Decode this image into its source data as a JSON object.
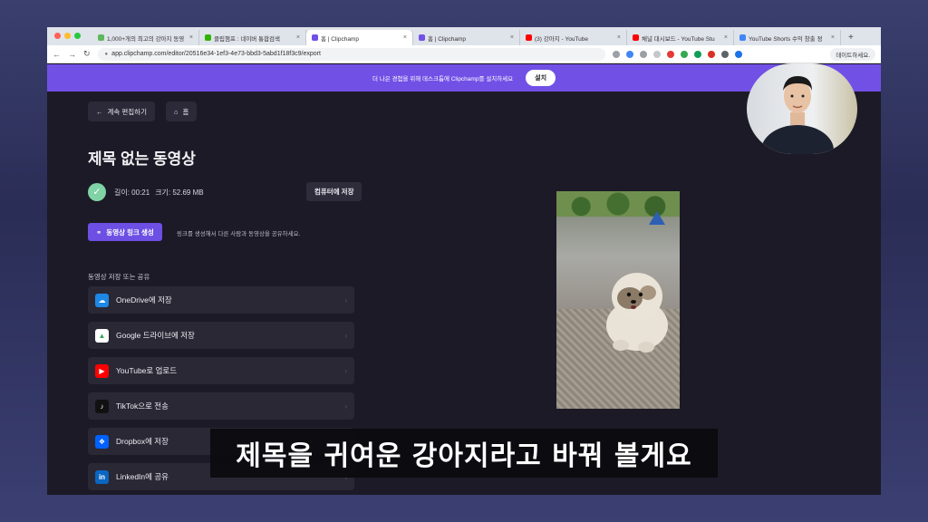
{
  "browser": {
    "tabs": [
      {
        "label": "1,000+개의 최고의 강아지 동영",
        "favicon_color": "#5cb85c",
        "active": false
      },
      {
        "label": "클립챔프 : 네이버 통합검색",
        "favicon_color": "#2db400",
        "active": false
      },
      {
        "label": "홈 | Clipchamp",
        "favicon_color": "#7150e6",
        "active": true
      },
      {
        "label": "홈 | Clipchamp",
        "favicon_color": "#7150e6",
        "active": false
      },
      {
        "label": "(3) 강아지 - YouTube",
        "favicon_color": "#ff0000",
        "active": false
      },
      {
        "label": "채널 대시보드 - YouTube Stu",
        "favicon_color": "#ff0000",
        "active": false
      },
      {
        "label": "YouTube Shorts 수익 창출 정",
        "favicon_color": "#4285f4",
        "active": false
      }
    ],
    "new_tab": "+",
    "url": "app.clipchamp.com/editor/20516e34-1ef3-4e73-bbd3-5abd1f18f3c9/export",
    "profile_label": "데이트하세요."
  },
  "promo": {
    "text": "더 나은 경험을 위해 데스크톱에 Clipchamp를 설치하세요",
    "button": "설치"
  },
  "nav": {
    "back_label": "계속 편집하기",
    "home_label": "홈"
  },
  "video": {
    "title": "제목 없는 동영상",
    "length": "길이: 00:21",
    "size": "크기: 52.69 MB",
    "save_pc": "컴퓨터에 저장"
  },
  "link": {
    "button": "동영상 링크 생성",
    "desc": "링크를 생성해서 다른 사람과 동영상을 공유하세요."
  },
  "share": {
    "section_title": "동영상 저장 또는 공유",
    "options": [
      {
        "label": "OneDrive에 저장",
        "icon": "onedrive-icon",
        "color": "#1e88e5"
      },
      {
        "label": "Google 드라이브에 저장",
        "icon": "google-drive-icon",
        "color": "#ffffff"
      },
      {
        "label": "YouTube로 업로드",
        "icon": "youtube-icon",
        "color": "#ff0000"
      },
      {
        "label": "TikTok으로 전송",
        "icon": "tiktok-icon",
        "color": "#111111"
      },
      {
        "label": "Dropbox에 저장",
        "icon": "dropbox-icon",
        "color": "#0061fe"
      },
      {
        "label": "LinkedIn에 공유",
        "icon": "linkedin-icon",
        "color": "#0a66c2"
      }
    ]
  },
  "caption": "제목을 귀여운 강아지라고 바꿔 볼게요",
  "colors": {
    "accent": "#7150e6",
    "background": "#1c1a26",
    "card": "#2a2835"
  }
}
